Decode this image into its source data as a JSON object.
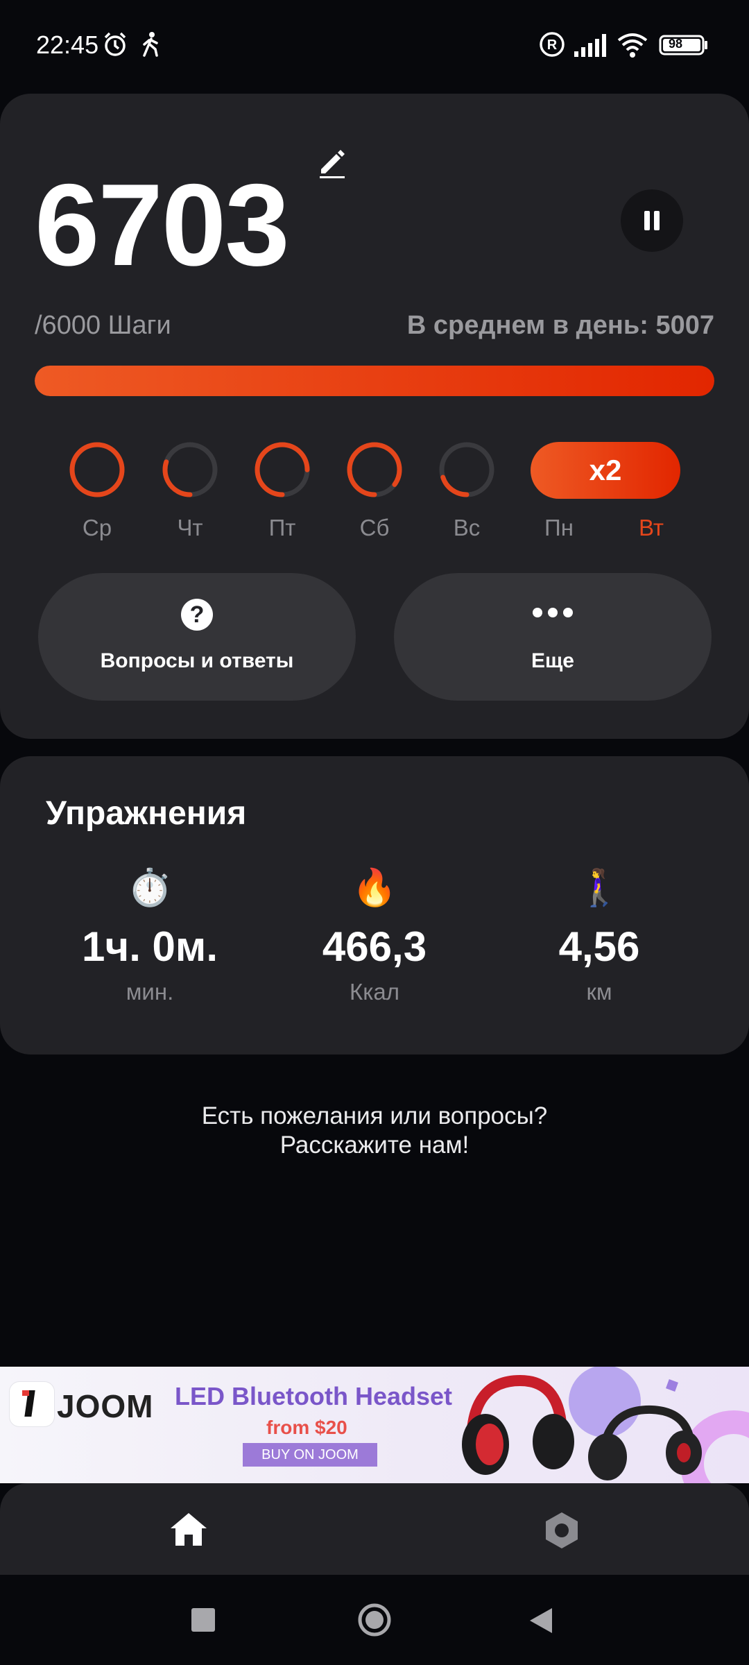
{
  "status_bar": {
    "time": "22:45",
    "icons": [
      "alarm-icon",
      "walking-icon",
      "registered-icon",
      "signal-icon",
      "wifi-icon",
      "battery-icon"
    ],
    "battery": "98"
  },
  "summary": {
    "steps": "6703",
    "goal_text": "/6000 Шаги",
    "average_text": "В среднем в день: 5007",
    "progress": 1.0,
    "colors": {
      "accent": "#e5461b",
      "card": "#222226",
      "background": "#07080c"
    }
  },
  "week": {
    "days": [
      {
        "label": "Ср",
        "progress": 1.0
      },
      {
        "label": "Чт",
        "progress": 0.3
      },
      {
        "label": "Пт",
        "progress": 0.75
      },
      {
        "label": "Сб",
        "progress": 0.85
      },
      {
        "label": "Вс",
        "progress": 0.2
      },
      {
        "label": "Пн",
        "badge": "x2"
      },
      {
        "label": "Вт",
        "active": true
      }
    ]
  },
  "actions": {
    "faq_label": "Вопросы и ответы",
    "more_label": "Еще"
  },
  "exercise": {
    "title": "Упражнения",
    "stats": [
      {
        "icon": "stopwatch-icon",
        "glyph": "⏱️",
        "value": "1ч. 0м.",
        "unit": "мин."
      },
      {
        "icon": "fire-icon",
        "glyph": "🔥",
        "value": "466,3",
        "unit": "Ккал"
      },
      {
        "icon": "walking-woman-icon",
        "glyph": "🚶‍♀️",
        "value": "4,56",
        "unit": "км"
      }
    ]
  },
  "feedback": {
    "line1": "Есть пожелания или вопросы?",
    "line2": "Расскажите нам!"
  },
  "ad": {
    "brand": "JOOM",
    "headline": "LED Bluetooth Headset",
    "price": "from $20",
    "cta": "BUY ON JOOM"
  },
  "bottom_nav": {
    "items": [
      {
        "icon": "home-icon",
        "active": true
      },
      {
        "icon": "settings-icon",
        "active": false
      }
    ]
  }
}
